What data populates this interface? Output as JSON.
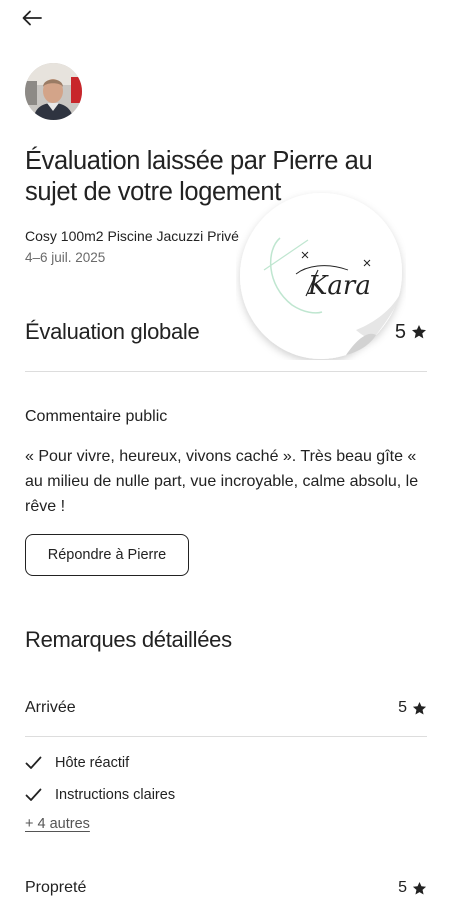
{
  "header": {
    "back_icon": "arrow-left-icon"
  },
  "reviewer": {
    "avatar_icon": "avatar-photo"
  },
  "review": {
    "title": "Évaluation laissée par Pierre au sujet de votre logement",
    "listing_name": "Cosy 100m2 Piscine Jacuzzi Privé",
    "dates": "4–6 juil. 2025",
    "global_label": "Évaluation globale",
    "global_rating": "5",
    "public_comment_label": "Commentaire public",
    "public_comment": "« Pour vivre, heureux, vivons caché ». Très beau gîte « au milieu de nulle part, vue incroyable, calme absolu, le rêve !",
    "reply_button": "Répondre à Pierre"
  },
  "details": {
    "title": "Remarques détaillées",
    "criteria": [
      {
        "label": "Arrivée",
        "rating": "5"
      },
      {
        "label": "Propreté",
        "rating": "5"
      }
    ],
    "tags": [
      "Hôte réactif",
      "Instructions claires"
    ],
    "more_link": "+ 4 autres"
  },
  "sticker": {
    "logo_text": "Kara"
  },
  "colors": {
    "text": "#222222",
    "secondary": "#6a6a6a",
    "divider": "#dddddd",
    "accent_green": "#9fd8b8"
  }
}
